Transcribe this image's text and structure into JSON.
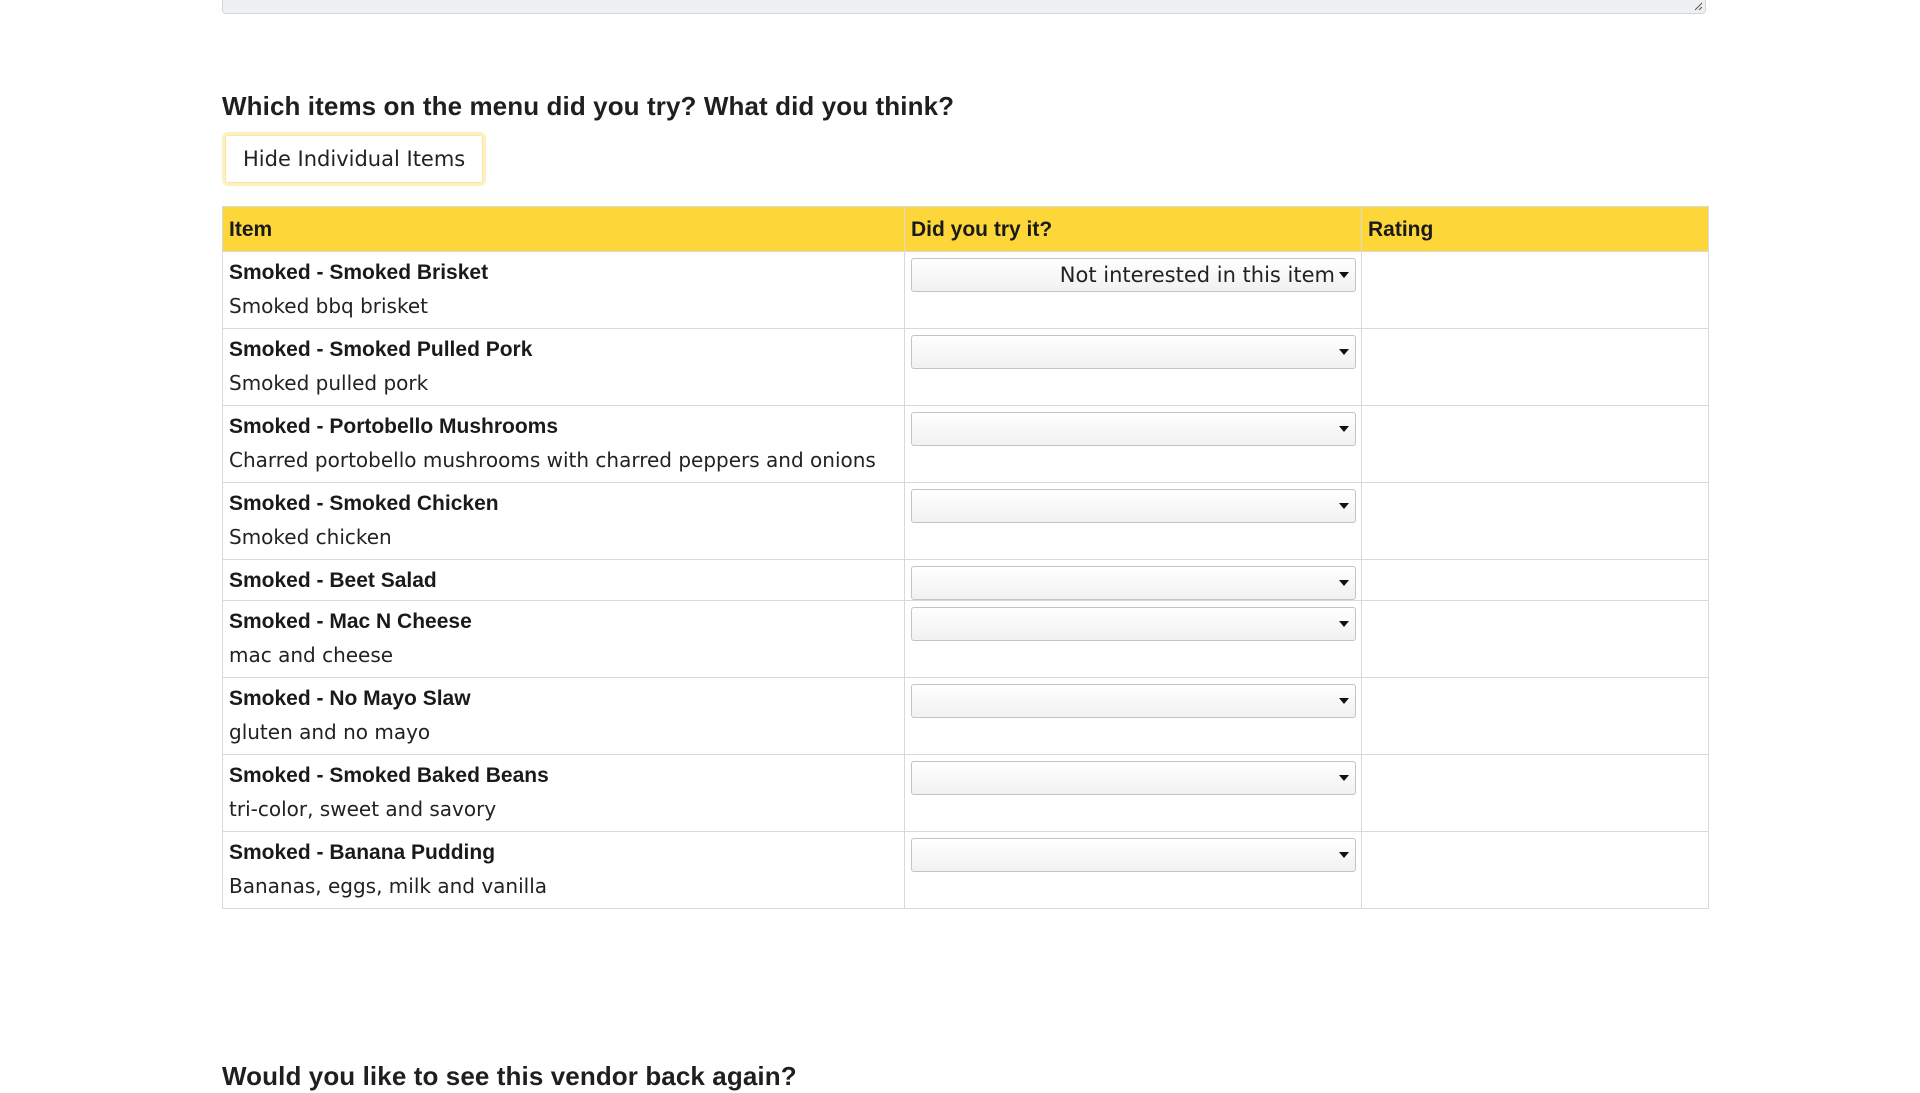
{
  "menu_question": "Which items on the menu did you try? What did you think?",
  "toggle_button_label": "Hide Individual Items",
  "table": {
    "headers": {
      "item": "Item",
      "tried": "Did you try it?",
      "rating": "Rating"
    },
    "rows": [
      {
        "name": "Smoked - Smoked Brisket",
        "description": "Smoked bbq brisket",
        "tried_value": "Not interested in this item"
      },
      {
        "name": "Smoked - Smoked Pulled Pork",
        "description": "Smoked pulled pork",
        "tried_value": ""
      },
      {
        "name": "Smoked - Portobello Mushrooms",
        "description": "Charred portobello mushrooms with charred peppers and onions",
        "tried_value": ""
      },
      {
        "name": "Smoked - Smoked Chicken",
        "description": "Smoked chicken",
        "tried_value": ""
      },
      {
        "name": "Smoked - Beet Salad",
        "description": "",
        "tried_value": ""
      },
      {
        "name": "Smoked - Mac N Cheese",
        "description": "mac and cheese",
        "tried_value": ""
      },
      {
        "name": "Smoked - No Mayo Slaw",
        "description": "gluten and no mayo",
        "tried_value": ""
      },
      {
        "name": "Smoked - Smoked Baked Beans",
        "description": "tri-color, sweet and savory",
        "tried_value": ""
      },
      {
        "name": "Smoked - Banana Pudding",
        "description": "Bananas, eggs, milk and vanilla",
        "tried_value": ""
      }
    ]
  },
  "vendor_question": "Would you like to see this vendor back again?",
  "colors": {
    "header_bg": "#fdd63a",
    "border": "#d9d9d9"
  }
}
